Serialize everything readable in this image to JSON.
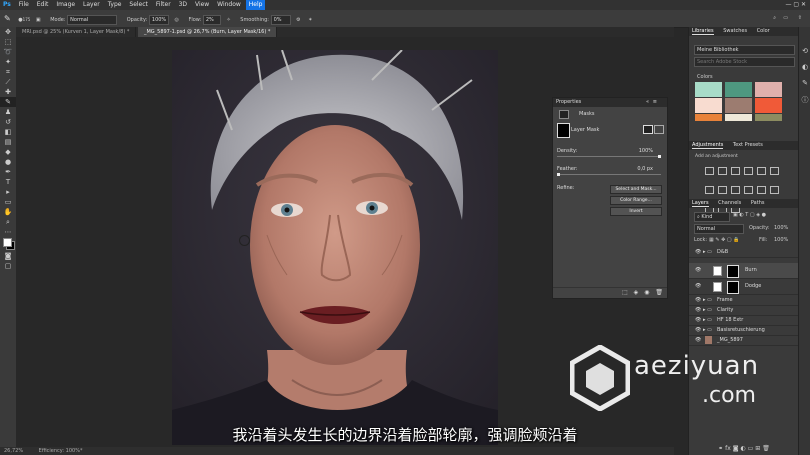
{
  "menu": [
    "File",
    "Edit",
    "Image",
    "Layer",
    "Type",
    "Select",
    "Filter",
    "3D",
    "View",
    "Window",
    "Help"
  ],
  "menu_active": "Help",
  "options": {
    "mode_label": "Mode:",
    "mode_value": "Normal",
    "opacity_label": "Opacity:",
    "opacity_value": "100%",
    "flow_label": "Flow:",
    "flow_value": "2%",
    "smoothing_label": "Smoothing:",
    "smoothing_value": "0%",
    "brush_size": "175"
  },
  "tabs": [
    {
      "label": "MRI.psd @ 25% (Kurven 1, Layer Mask/8) *"
    },
    {
      "label": "_MG_5897-1.psd @ 26,7% (Burn, Layer Mask/16) *"
    }
  ],
  "status": {
    "zoom": "26,72%",
    "info": "Efficiency: 100%*"
  },
  "properties": {
    "title": "Properties",
    "mode": "Masks",
    "layer_mask": "Layer Mask",
    "density_label": "Density:",
    "density_value": "100%",
    "feather_label": "Feather:",
    "feather_value": "0,0 px",
    "refine_label": "Refine:",
    "btn_select_mask": "Select and Mask...",
    "btn_color_range": "Color Range...",
    "btn_invert": "Invert",
    "density_level": 1.0,
    "feather_level": 0.0
  },
  "libraries": {
    "tabs": [
      "Libraries",
      "Swatches",
      "Color"
    ],
    "library_name": "Meine Bibliothek",
    "search_placeholder": "Search Adobe Stock",
    "section": "Colors",
    "swatches": [
      "#a8dcc8",
      "#4e9880",
      "#e0b0ac",
      "#f8dcd0",
      "#9c7c70",
      "#f05a38",
      "#e8823a",
      "#eee8d8",
      "#8c8c60"
    ]
  },
  "adjustments": {
    "tabs": [
      "Adjustments",
      "Text Presets"
    ],
    "add_label": "Add an adjustment"
  },
  "layers_panel": {
    "tabs": [
      "Layers",
      "Channels",
      "Paths"
    ],
    "filter_value": "Kind",
    "blend_value": "Normal",
    "opacity_label": "Opacity:",
    "opacity_value": "100%",
    "lock_label": "Lock:",
    "fill_label": "Fill:",
    "fill_value": "100%",
    "layers": [
      {
        "name": "D&B",
        "type": "group"
      },
      {
        "name": "Burn",
        "type": "mask"
      },
      {
        "name": "Dodge",
        "type": "mask"
      },
      {
        "name": "Frame",
        "type": "group"
      },
      {
        "name": "Clarity",
        "type": "group"
      },
      {
        "name": "HF 18 Extr",
        "type": "group"
      },
      {
        "name": "Basisretuschierung",
        "type": "group"
      },
      {
        "name": "_MG_5897",
        "type": "image"
      }
    ]
  },
  "subtitle": "我沿着头发生长的边界沿着脸部轮廓，强调脸颊沿着",
  "watermark": {
    "line1": "aeziyuan",
    "line2": ".com"
  }
}
